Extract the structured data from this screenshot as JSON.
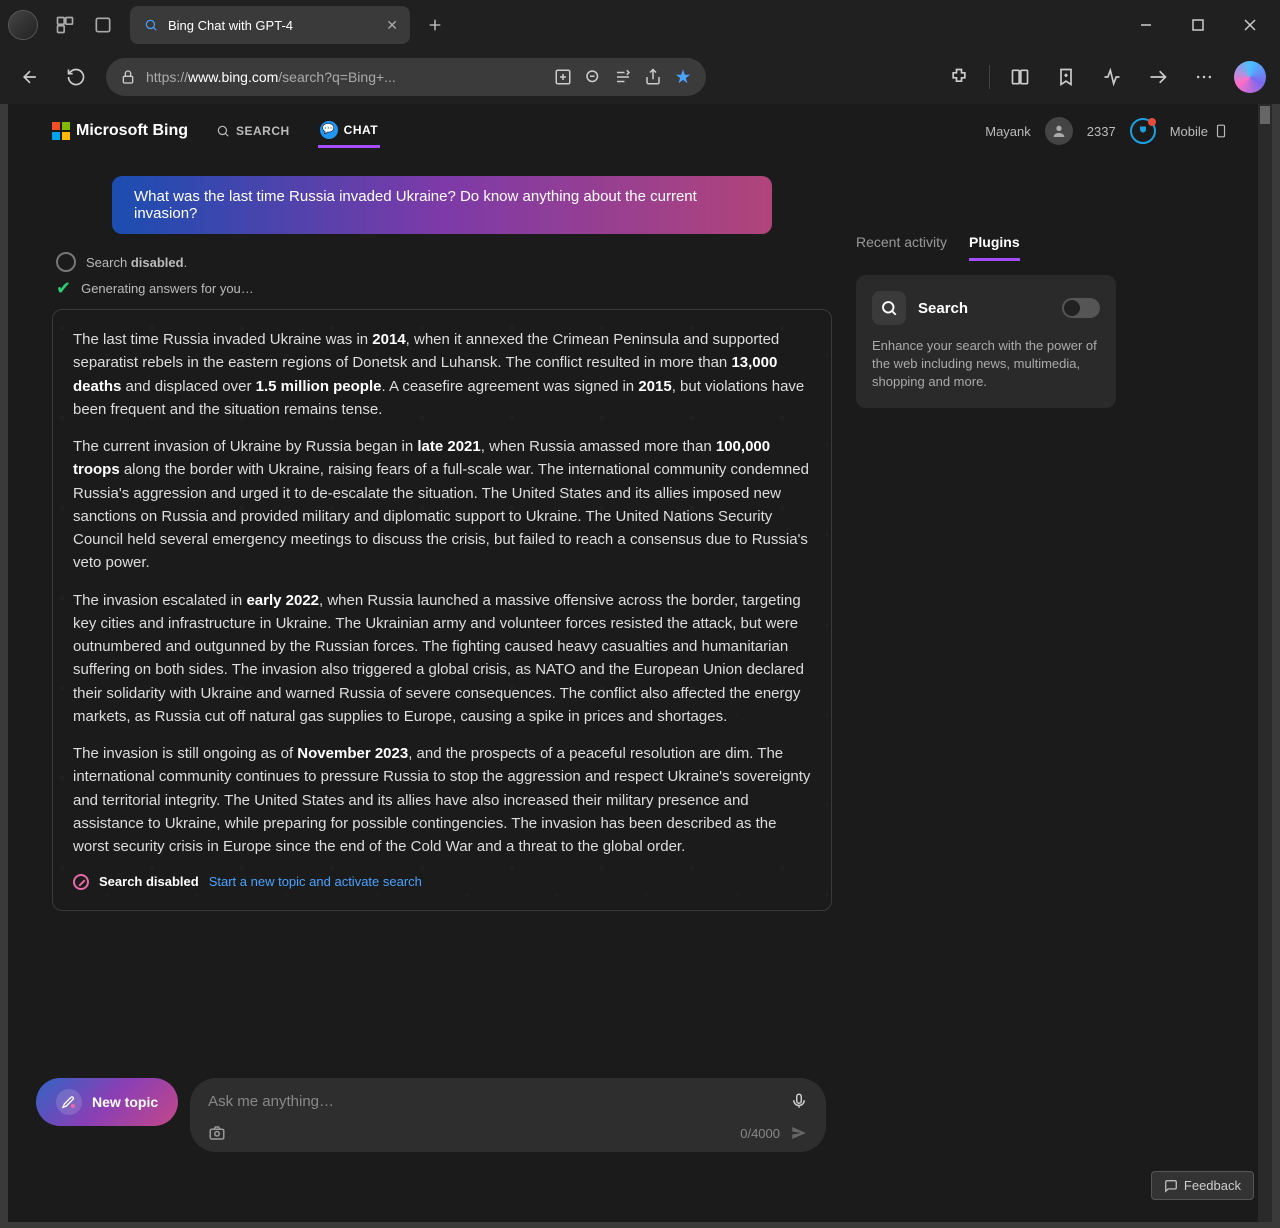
{
  "titlebar": {
    "tab_title": "Bing Chat with GPT-4"
  },
  "toolbar": {
    "url_prefix": "https://",
    "url_host": "www.bing.com",
    "url_path": "/search?q=Bing+..."
  },
  "header": {
    "logo_text": "Microsoft Bing",
    "search_tab": "SEARCH",
    "chat_tab": "CHAT",
    "user_name": "Mayank",
    "points": "2337",
    "mobile": "Mobile"
  },
  "query": "What was the last time Russia invaded Ukraine? Do know anything about the current invasion?",
  "status": {
    "search_label": "Search ",
    "search_state": "disabled",
    "search_suffix": ".",
    "generating": "Generating answers for you…"
  },
  "answer": {
    "p1a": "The last time Russia invaded Ukraine was in ",
    "p1b": "2014",
    "p1c": ", when it annexed the Crimean Peninsula and supported separatist rebels in the eastern regions of Donetsk and Luhansk. The conflict resulted in more than ",
    "p1d": "13,000 deaths",
    "p1e": " and displaced over ",
    "p1f": "1.5 million people",
    "p1g": ". A ceasefire agreement was signed in ",
    "p1h": "2015",
    "p1i": ", but violations have been frequent and the situation remains tense.",
    "p2a": "The current invasion of Ukraine by Russia began in ",
    "p2b": "late 2021",
    "p2c": ", when Russia amassed more than ",
    "p2d": "100,000 troops",
    "p2e": " along the border with Ukraine, raising fears of a full-scale war. The international community condemned Russia's aggression and urged it to de-escalate the situation. The United States and its allies imposed new sanctions on Russia and provided military and diplomatic support to Ukraine. The United Nations Security Council held several emergency meetings to discuss the crisis, but failed to reach a consensus due to Russia's veto power.",
    "p3a": "The invasion escalated in ",
    "p3b": "early 2022",
    "p3c": ", when Russia launched a massive offensive across the border, targeting key cities and infrastructure in Ukraine. The Ukrainian army and volunteer forces resisted the attack, but were outnumbered and outgunned by the Russian forces. The fighting caused heavy casualties and humanitarian suffering on both sides. The invasion also triggered a global crisis, as NATO and the European Union declared their solidarity with Ukraine and warned Russia of severe consequences. The conflict also affected the energy markets, as Russia cut off natural gas supplies to Europe, causing a spike in prices and shortages.",
    "p4a": "The invasion is still ongoing as of ",
    "p4b": "November 2023",
    "p4c": ", and the prospects of a peaceful resolution are dim. The international community continues to pressure Russia to stop the aggression and respect Ukraine's sovereignty and territorial integrity. The United States and its allies have also increased their military presence and assistance to Ukraine, while preparing for possible contingencies. The invasion has been described as the worst security crisis in Europe since the end of the Cold War and a threat to the global order."
  },
  "answer_footer": {
    "disabled_text": "Search disabled",
    "link_text": "Start a new topic and activate search"
  },
  "right_panel": {
    "tab_recent": "Recent activity",
    "tab_plugins": "Plugins",
    "plugin_name": "Search",
    "plugin_desc": "Enhance your search with the power of the web including news, multimedia, shopping and more."
  },
  "input": {
    "new_topic": "New topic",
    "placeholder": "Ask me anything…",
    "counter": "0/4000"
  },
  "feedback": "Feedback"
}
